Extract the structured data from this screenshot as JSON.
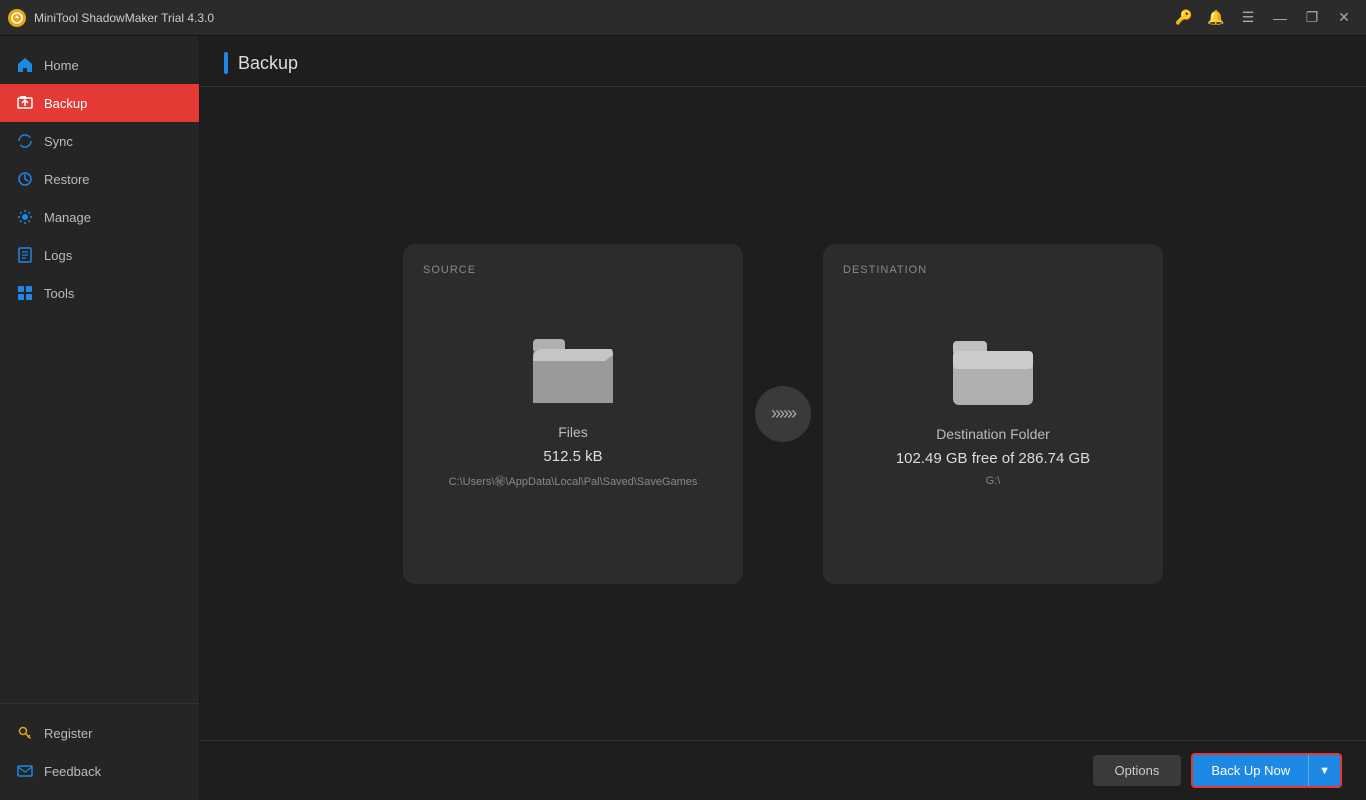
{
  "app": {
    "title": "MiniTool ShadowMaker Trial 4.3.0"
  },
  "titlebar": {
    "title": "MiniTool ShadowMaker Trial 4.3.0",
    "controls": {
      "minimize": "—",
      "maximize": "❐",
      "close": "✕"
    }
  },
  "sidebar": {
    "items": [
      {
        "id": "home",
        "label": "Home",
        "icon": "home-icon",
        "active": false
      },
      {
        "id": "backup",
        "label": "Backup",
        "icon": "backup-icon",
        "active": true
      },
      {
        "id": "sync",
        "label": "Sync",
        "icon": "sync-icon",
        "active": false
      },
      {
        "id": "restore",
        "label": "Restore",
        "icon": "restore-icon",
        "active": false
      },
      {
        "id": "manage",
        "label": "Manage",
        "icon": "manage-icon",
        "active": false
      },
      {
        "id": "logs",
        "label": "Logs",
        "icon": "logs-icon",
        "active": false
      },
      {
        "id": "tools",
        "label": "Tools",
        "icon": "tools-icon",
        "active": false
      }
    ],
    "bottom_items": [
      {
        "id": "register",
        "label": "Register",
        "icon": "key-icon"
      },
      {
        "id": "feedback",
        "label": "Feedback",
        "icon": "mail-icon"
      }
    ]
  },
  "page": {
    "title": "Backup"
  },
  "source_card": {
    "label": "SOURCE",
    "icon_type": "folder-open",
    "name": "Files",
    "size": "512.5 kB",
    "path": "C:\\Users\\㊙\\AppData\\Local\\Pal\\Saved\\SaveGames"
  },
  "destination_card": {
    "label": "DESTINATION",
    "icon_type": "folder",
    "name": "Destination Folder",
    "free_space": "102.49 GB free of 286.74 GB",
    "path": "G:\\"
  },
  "arrow": {
    "symbol": "»»»"
  },
  "bottom_bar": {
    "options_label": "Options",
    "backup_now_label": "Back Up Now",
    "dropdown_arrow": "▼"
  }
}
